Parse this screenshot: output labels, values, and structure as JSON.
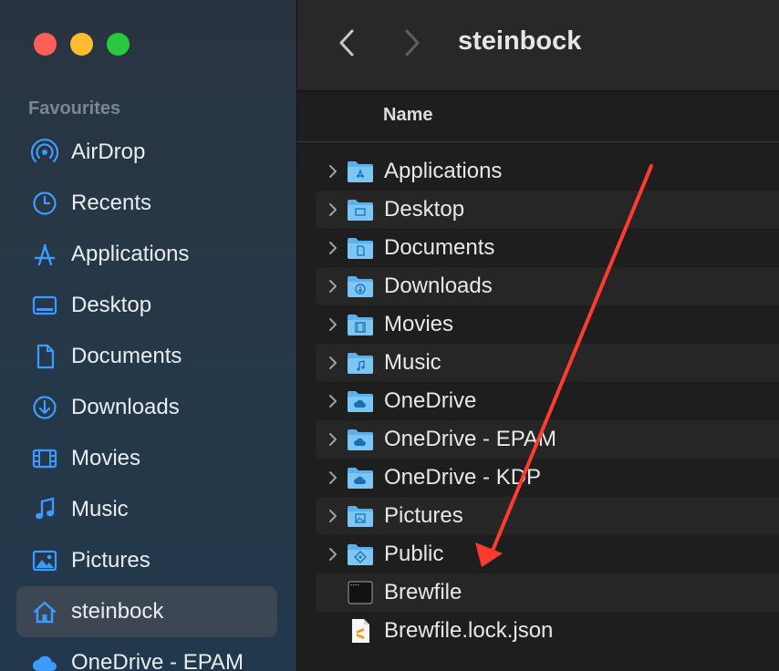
{
  "window": {
    "title": "steinbock",
    "traffic_lights": {
      "close": "#fe5f57",
      "minimize": "#febc2e",
      "zoom": "#28c840"
    }
  },
  "sidebar": {
    "section_title": "Favourites",
    "accent": "#3d9bff",
    "items": [
      {
        "label": "AirDrop",
        "icon": "airdrop-icon"
      },
      {
        "label": "Recents",
        "icon": "clock-icon"
      },
      {
        "label": "Applications",
        "icon": "applications-icon"
      },
      {
        "label": "Desktop",
        "icon": "desktop-icon"
      },
      {
        "label": "Documents",
        "icon": "document-icon"
      },
      {
        "label": "Downloads",
        "icon": "download-icon"
      },
      {
        "label": "Movies",
        "icon": "film-icon"
      },
      {
        "label": "Music",
        "icon": "music-note-icon"
      },
      {
        "label": "Pictures",
        "icon": "photo-icon"
      },
      {
        "label": "steinbock",
        "icon": "home-icon",
        "selected": true
      },
      {
        "label": "OneDrive - EPAM",
        "icon": "cloud-icon"
      }
    ]
  },
  "file_list": {
    "column_header": "Name",
    "rows": [
      {
        "name": "Applications",
        "kind": "folder",
        "glyph": "apps"
      },
      {
        "name": "Desktop",
        "kind": "folder",
        "glyph": "desktop"
      },
      {
        "name": "Documents",
        "kind": "folder",
        "glyph": "doc"
      },
      {
        "name": "Downloads",
        "kind": "folder",
        "glyph": "download"
      },
      {
        "name": "Movies",
        "kind": "folder",
        "glyph": "film"
      },
      {
        "name": "Music",
        "kind": "folder",
        "glyph": "music"
      },
      {
        "name": "OneDrive",
        "kind": "folder",
        "glyph": "cloud"
      },
      {
        "name": "OneDrive - EPAM",
        "kind": "folder",
        "glyph": "cloud"
      },
      {
        "name": "OneDrive - KDP",
        "kind": "folder",
        "glyph": "cloud"
      },
      {
        "name": "Pictures",
        "kind": "folder",
        "glyph": "photo"
      },
      {
        "name": "Public",
        "kind": "folder",
        "glyph": "public"
      },
      {
        "name": "Brewfile",
        "kind": "terminal-file"
      },
      {
        "name": "Brewfile.lock.json",
        "kind": "sublime-file"
      }
    ]
  },
  "annotation": {
    "color": "#ff3b30"
  }
}
